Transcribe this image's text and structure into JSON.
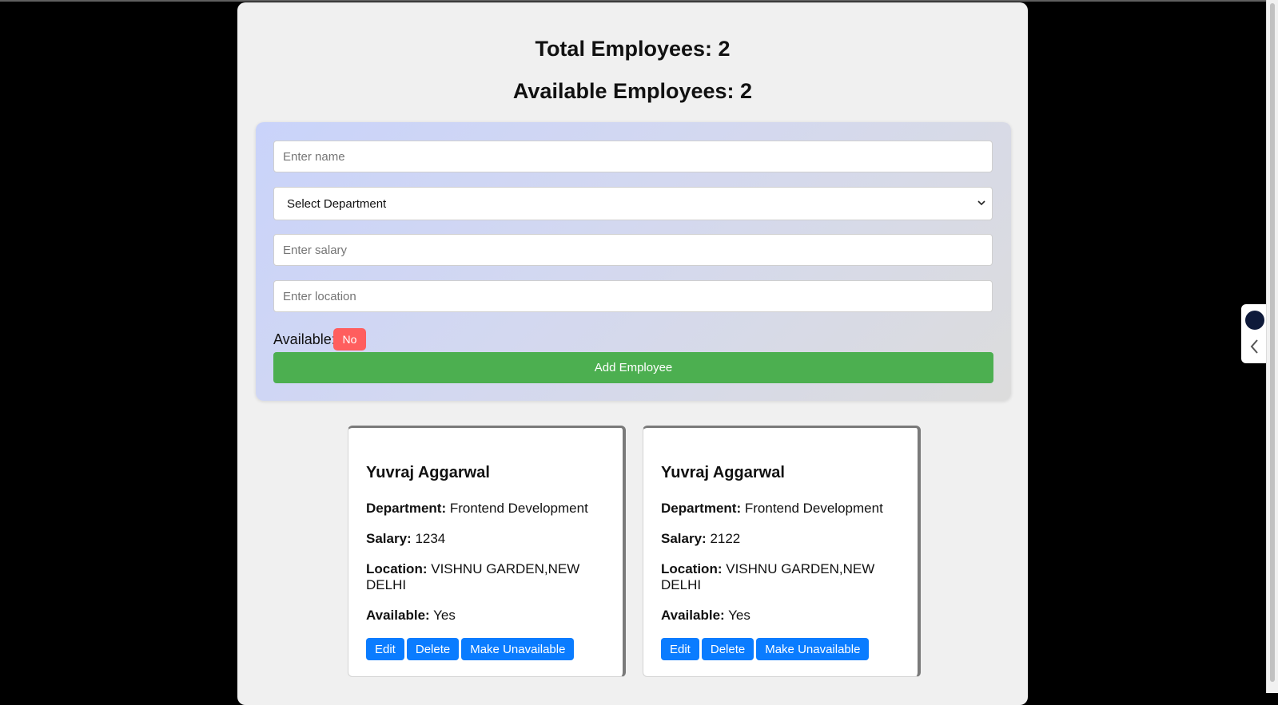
{
  "stats": {
    "total_text": "Total Employees: 2",
    "available_text": "Available Employees: 2"
  },
  "form": {
    "name_placeholder": "Enter name",
    "department_selected": "Select Department",
    "salary_placeholder": "Enter salary",
    "location_placeholder": "Enter location",
    "available_label": "Available:",
    "available_toggle": "No",
    "add_button": "Add Employee"
  },
  "employees": [
    {
      "name": "Yuvraj Aggarwal",
      "department_label": "Department:",
      "department": "Frontend Development",
      "salary_label": "Salary:",
      "salary": "1234",
      "location_label": "Location:",
      "location": "VISHNU GARDEN,NEW DELHI",
      "available_label": "Available:",
      "available": "Yes",
      "actions": {
        "edit": "Edit",
        "delete": "Delete",
        "toggle": "Make Unavailable"
      }
    },
    {
      "name": "Yuvraj Aggarwal",
      "department_label": "Department:",
      "department": "Frontend Development",
      "salary_label": "Salary:",
      "salary": "2122",
      "location_label": "Location:",
      "location": "VISHNU GARDEN,NEW DELHI",
      "available_label": "Available:",
      "available": "Yes",
      "actions": {
        "edit": "Edit",
        "delete": "Delete",
        "toggle": "Make Unavailable"
      }
    }
  ],
  "colors": {
    "add_button": "#4caf50",
    "toggle_no": "#ff5e5e",
    "action_button": "#0a7cff",
    "page_background": "#000000",
    "app_background": "#f0f0f0"
  },
  "icons": {
    "select_chevron": "chevron-down-icon",
    "side_logo": "extension-logo-icon",
    "side_collapse": "chevron-left-icon"
  }
}
